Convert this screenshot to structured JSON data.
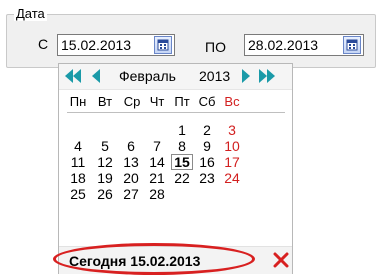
{
  "group": {
    "title": "Дата"
  },
  "from": {
    "label": "С",
    "value": "15.02.2013"
  },
  "to": {
    "label": "ПО",
    "value": "28.02.2013"
  },
  "calendar": {
    "month": "Февраль",
    "year": "2013",
    "weekdays": [
      "Пн",
      "Вт",
      "Ср",
      "Чт",
      "Пт",
      "Сб",
      "Вс"
    ],
    "weeks": [
      [
        "",
        "",
        "",
        "",
        "1",
        "2",
        "3"
      ],
      [
        "4",
        "5",
        "6",
        "7",
        "8",
        "9",
        "10"
      ],
      [
        "11",
        "12",
        "13",
        "14",
        "15",
        "16",
        "17"
      ],
      [
        "18",
        "19",
        "20",
        "21",
        "22",
        "23",
        "24"
      ],
      [
        "25",
        "26",
        "27",
        "28",
        "",
        "",
        ""
      ]
    ],
    "selected_day": "15",
    "today_label": "Сегодня 15.02.2013"
  },
  "colors": {
    "weekend": "#d21f1f",
    "nav_arrow": "#1a9aa8",
    "highlight": "#d82020"
  },
  "icons": {
    "prev_year": "double-left-arrow",
    "prev_month": "left-arrow",
    "next_month": "right-arrow",
    "next_year": "double-right-arrow",
    "close": "red-x"
  }
}
